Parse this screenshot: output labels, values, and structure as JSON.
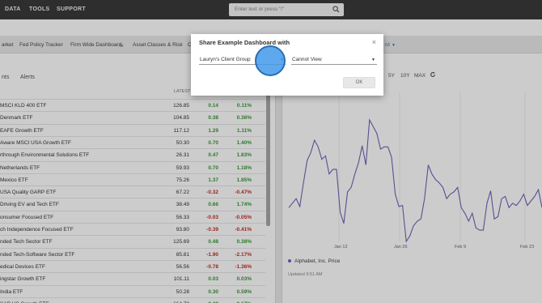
{
  "topnav": {
    "items": [
      "DATA",
      "TOOLS",
      "SUPPORT"
    ]
  },
  "search": {
    "placeholder": "Enter text or press \"/\""
  },
  "dashboard_tabs": [
    "arket",
    "Fed Policy Tracker",
    "Firm Wide Dashboard",
    "Asset Classes & Risk",
    "C",
    "rd"
  ],
  "subtabs": [
    "nts",
    "Alerts"
  ],
  "table": {
    "header_latest": "LATEST",
    "rows": [
      {
        "name": "MSCI KLD 400 ETF",
        "latest": "126.85",
        "change": "0.14",
        "pct": "0.11%"
      },
      {
        "name": "Denmark ETF",
        "latest": "104.85",
        "change": "0.38",
        "pct": "0.36%"
      },
      {
        "name": "EAFE Growth ETF",
        "latest": "117.12",
        "change": "1.29",
        "pct": "1.11%"
      },
      {
        "name": "Aware MSCI USA Growth ETF",
        "latest": "50.30",
        "change": "0.70",
        "pct": "1.40%"
      },
      {
        "name": "rthrough Environmental Solutions ETF",
        "latest": "26.31",
        "change": "0.47",
        "pct": "1.83%"
      },
      {
        "name": "Netherlands ETF",
        "latest": "59.93",
        "change": "0.70",
        "pct": "1.18%"
      },
      {
        "name": "Mexico ETF",
        "latest": "75.26",
        "change": "1.37",
        "pct": "1.85%"
      },
      {
        "name": "USA Quality GARP ETF",
        "latest": "67.22",
        "change": "-0.32",
        "pct": "-0.47%"
      },
      {
        "name": "Driving EV and Tech ETF",
        "latest": "38.49",
        "change": "0.66",
        "pct": "1.74%"
      },
      {
        "name": "onsumer Focused ETF",
        "latest": "56.33",
        "change": "-0.03",
        "pct": "-0.05%"
      },
      {
        "name": "ch Independence Focused ETF",
        "latest": "93.80",
        "change": "-0.39",
        "pct": "-0.41%"
      },
      {
        "name": "nded Tech Sector ETF",
        "latest": "125.69",
        "change": "0.48",
        "pct": "0.38%"
      },
      {
        "name": "nded Tech-Software Sector ETF",
        "latest": "85.81",
        "change": "-1.90",
        "pct": "-2.17%"
      },
      {
        "name": "edical Devices ETF",
        "latest": "56.56",
        "change": "-0.78",
        "pct": "-1.36%"
      },
      {
        "name": "ingstar Growth ETF",
        "latest": "101.11",
        "change": "0.03",
        "pct": "0.03%"
      },
      {
        "name": "India ETF",
        "latest": "50.28",
        "change": "0.30",
        "pct": "0.59%"
      },
      {
        "name": "SAP US Growth ETF",
        "latest": "164.78",
        "change": "0.29",
        "pct": "0.17%"
      }
    ]
  },
  "chart_controls": {
    "ranges": [
      "5Y",
      "10Y",
      "MAX"
    ]
  },
  "chart_data": {
    "type": "line",
    "x_tick_labels": [
      "Jan 12",
      "Jan 26",
      "Feb 9",
      "Feb 23"
    ],
    "series": [
      {
        "name": "Alphabet, Inc. Price",
        "color": "#6e64b5",
        "values": [
          30,
          34,
          38,
          31,
          52,
          72,
          79,
          90,
          84,
          73,
          76,
          60,
          64,
          64,
          26,
          16,
          44,
          48,
          60,
          70,
          85,
          68,
          108,
          102,
          96,
          82,
          84,
          84,
          75,
          42,
          31,
          32,
          0,
          5,
          14,
          18,
          20,
          38,
          68,
          60,
          55,
          52,
          48,
          38,
          42,
          44,
          48,
          30,
          25,
          18,
          25,
          12,
          10,
          10,
          34,
          45,
          20,
          22,
          38,
          40,
          30,
          34,
          32,
          36,
          42,
          32,
          36,
          40,
          46,
          30
        ]
      }
    ]
  },
  "legend": {
    "label": "Alphabet, Inc. Price"
  },
  "updated": {
    "text": "Updated 9:51 AM"
  },
  "modal": {
    "title": "Share Example Dashboard with",
    "close": "×",
    "group_value": "Lauryn's Client Group",
    "permission_value": "Cannot View",
    "caret": "▼",
    "ok_label": "OK"
  }
}
